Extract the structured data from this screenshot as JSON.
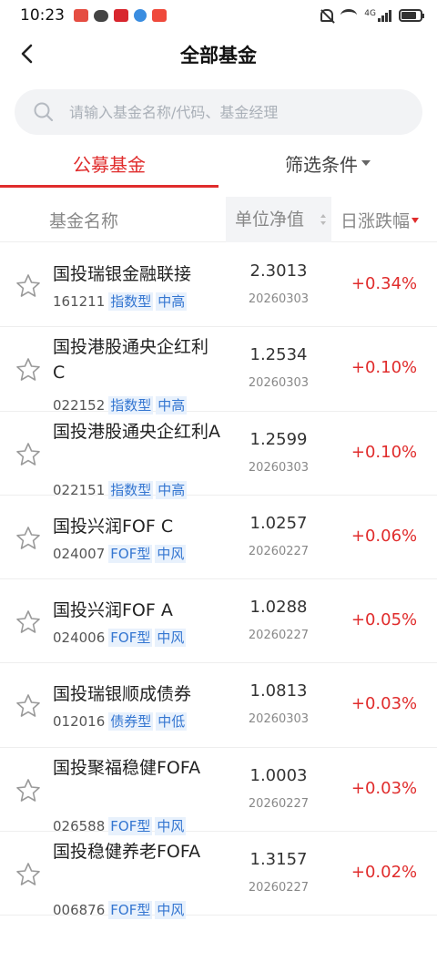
{
  "status_bar": {
    "time": "10:23",
    "network": "4G"
  },
  "nav": {
    "title": "全部基金"
  },
  "search": {
    "placeholder": "请输入基金名称/代码、基金经理"
  },
  "tabs": {
    "public": "公募基金",
    "filter": "筛选条件"
  },
  "header": {
    "name": "基金名称",
    "nav": "单位净值",
    "change": "日涨跌幅"
  },
  "colors": {
    "accent": "#e02c2c",
    "tag_text": "#3476d1",
    "tag_bg": "#e8f1fc"
  },
  "funds": [
    {
      "name": "国投瑞银金融联接",
      "code": "161211",
      "type": "指数型",
      "risk": "中高",
      "nav": "2.3013",
      "date": "20260303",
      "change": "+0.34%"
    },
    {
      "name": "国投港股通央企红利C",
      "code": "022152",
      "type": "指数型",
      "risk": "中高",
      "nav": "1.2534",
      "date": "20260303",
      "change": "+0.10%"
    },
    {
      "name": "国投港股通央企红利A",
      "code": "022151",
      "type": "指数型",
      "risk": "中高",
      "nav": "1.2599",
      "date": "20260303",
      "change": "+0.10%"
    },
    {
      "name": "国投兴润FOF C",
      "code": "024007",
      "type": "FOF型",
      "risk": "中风",
      "nav": "1.0257",
      "date": "20260227",
      "change": "+0.06%"
    },
    {
      "name": "国投兴润FOF A",
      "code": "024006",
      "type": "FOF型",
      "risk": "中风",
      "nav": "1.0288",
      "date": "20260227",
      "change": "+0.05%"
    },
    {
      "name": "国投瑞银顺成债券",
      "code": "012016",
      "type": "债券型",
      "risk": "中低",
      "nav": "1.0813",
      "date": "20260303",
      "change": "+0.03%"
    },
    {
      "name": "国投聚福稳健FOFA",
      "code": "026588",
      "type": "FOF型",
      "risk": "中风",
      "nav": "1.0003",
      "date": "20260227",
      "change": "+0.03%"
    },
    {
      "name": "国投稳健养老FOFA",
      "code": "006876",
      "type": "FOF型",
      "risk": "中风",
      "nav": "1.3157",
      "date": "20260227",
      "change": "+0.02%"
    }
  ]
}
